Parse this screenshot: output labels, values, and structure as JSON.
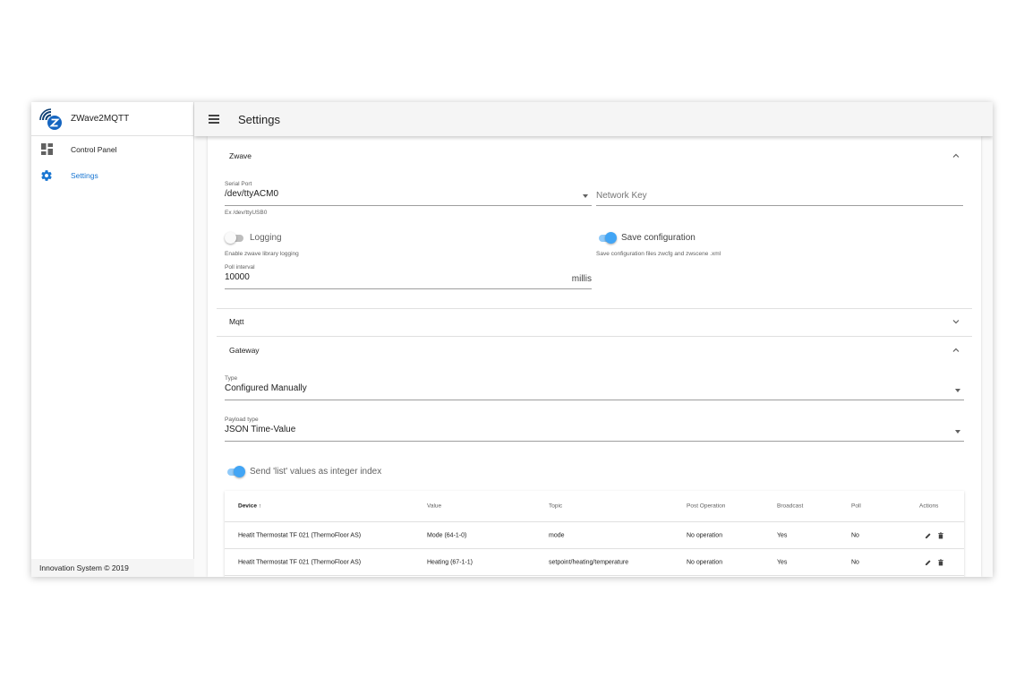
{
  "app": {
    "name": "ZWave2MQTT",
    "footer": "Innovation System © 2019"
  },
  "sidebar": {
    "items": [
      {
        "label": "Control Panel",
        "icon": "dashboard-icon"
      },
      {
        "label": "Settings",
        "icon": "gear-icon",
        "active": true
      }
    ]
  },
  "appbar": {
    "title": "Settings",
    "menu_icon": "menu-icon"
  },
  "colors": {
    "accent": "#1976d2",
    "switch_on": "#42a5f5",
    "switch_track_on": "#90caf9"
  },
  "zwave": {
    "title": "Zwave",
    "expanded": true,
    "serial_port": {
      "label": "Serial Port",
      "value": "/dev/ttyACM0",
      "hint": "Ex /dev/ttyUSB0"
    },
    "network_key": {
      "placeholder": "Network Key",
      "value": ""
    },
    "logging": {
      "label": "Logging",
      "enabled": false,
      "hint": "Enable zwave library logging"
    },
    "save_config": {
      "label": "Save configuration",
      "enabled": true,
      "hint": "Save configuration files zwcfg and zwscene .xml"
    },
    "poll_interval": {
      "label": "Poll interval",
      "value": "10000",
      "suffix": "millis"
    }
  },
  "mqtt": {
    "title": "Mqtt",
    "expanded": false
  },
  "gateway": {
    "title": "Gateway",
    "expanded": true,
    "type": {
      "label": "Type",
      "value": "Configured Manually"
    },
    "payload_type": {
      "label": "Payload type",
      "value": "JSON Time-Value"
    },
    "send_list_index": {
      "label": "Send 'list' values as integer index",
      "enabled": true
    }
  },
  "table": {
    "headers": {
      "device": "Device",
      "value": "Value",
      "topic": "Topic",
      "post_operation": "Post Operation",
      "broadcast": "Broadcast",
      "poll": "Poll",
      "actions": "Actions"
    },
    "sort_column": "Device",
    "rows": [
      {
        "device": "Heatit Thermostat TF 021 (ThermoFloor AS)",
        "value": "Mode (64-1-0)",
        "topic": "mode",
        "post_operation": "No operation",
        "broadcast": "Yes",
        "poll": "No"
      },
      {
        "device": "Heatit Thermostat TF 021 (ThermoFloor AS)",
        "value": "Heating (67-1-1)",
        "topic": "setpoint/heating/temperature",
        "post_operation": "No operation",
        "broadcast": "Yes",
        "poll": "No"
      }
    ]
  }
}
